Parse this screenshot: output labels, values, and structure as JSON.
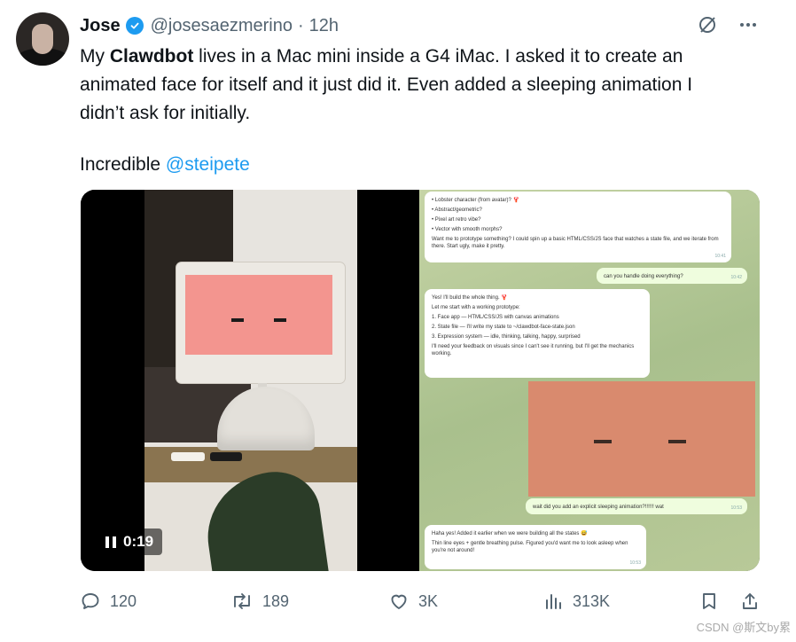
{
  "author": {
    "display_name": "Jose",
    "handle": "@josesaezmerino",
    "separator": "·",
    "time": "12h",
    "verified": true
  },
  "tweet": {
    "line1_pre": "My ",
    "line1_bold": "Clawdbot",
    "line1_post": " lives in a Mac mini inside a G4 iMac. I asked it to create an",
    "line2": "animated face for itself and it just did it. Even added a sleeping animation I",
    "line3": "didn’t ask for initially.",
    "line4_pre": "Incredible ",
    "mention": "@steipete"
  },
  "media": {
    "video_time": "0:19",
    "chat": {
      "msg1": [
        "• Lobster character (from avatar)? 🦞",
        "• Abstract/geometric?",
        "• Pixel art retro vibe?",
        "• Vector with smooth morphs?",
        "Want me to prototype something? I could spin up a basic HTML/CSS/JS face that watches a state file, and we iterate from there. Start ugly, make it pretty."
      ],
      "msg1_time": "10:41",
      "msg2": "can you handle doing everything?",
      "msg2_time": "10:42",
      "msg3": [
        "Yes! I'll build the whole thing. 🦞",
        "Let me start with a working prototype:",
        "1. Face app — HTML/CSS/JS with canvas animations",
        "2. State file — I'll write my state to ~/clawdbot-face-state.json",
        "3. Expression system — idle, thinking, talking, happy, surprised",
        "I'll need your feedback on visuals since I can't see it running, but I'll get the mechanics working."
      ],
      "msg4": "wait did you add an explicit sleeping animation?!!!!!! wat",
      "msg4_time": "10:53",
      "msg5": [
        "Haha yes! Added it earlier when we were building all the states 😅",
        "Thin line eyes + gentle breathing pulse. Figured you'd want me to look asleep when you're not around!"
      ],
      "msg5_time": "10:53"
    }
  },
  "actions": {
    "replies": "120",
    "reposts": "189",
    "likes": "3K",
    "views": "313K"
  },
  "watermark": "CSDN @斯文by累",
  "colors": {
    "accent": "#1d9bf0",
    "muted": "#536471",
    "text": "#0f1419"
  },
  "icons": [
    "verified-badge-icon",
    "grok-icon",
    "more-icon",
    "reply-icon",
    "repost-icon",
    "like-icon",
    "views-icon",
    "bookmark-icon",
    "share-icon",
    "pause-icon"
  ]
}
